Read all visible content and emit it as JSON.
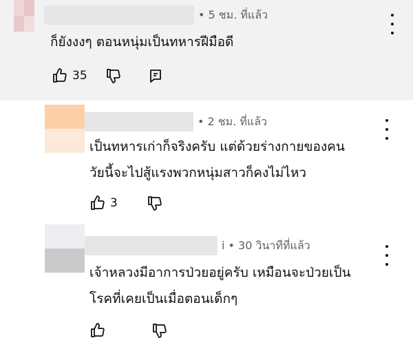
{
  "comments": [
    {
      "time": "• 5 ชม. ที่แล้ว",
      "text_lines": [
        "ก็ยังงงๆ ตอนหนุ่มเป็นทหารฝีมือดี"
      ],
      "likes": "35"
    },
    {
      "time": "• 2 ชม. ที่แล้ว",
      "text_lines": [
        "เป็นทหารเก่าก็จริงครับ แต่ด้วยร่างกายของคน",
        "วัยนี้จะไปสู้แรงพวกหนุ่มสาวก็คงไม่ไหว"
      ],
      "likes": "3"
    },
    {
      "time": "i • 30 วินาทีที่แล้ว",
      "text_lines": [
        "เจ้าหลวงมีอาการป่วยอยู่ครับ เหมือนจะป่วยเป็น",
        "โรคที่เคยเป็นเมื่อตอนเด็กๆ"
      ],
      "likes": ""
    }
  ],
  "icons": {
    "like": "thumb-up-icon",
    "dislike": "thumb-down-icon",
    "reply": "reply-icon",
    "menu": "more-vert-icon"
  },
  "colors": {
    "highlight_bg": "#f2f2f2",
    "text": "#0f0f0f",
    "secondary": "#606060"
  }
}
